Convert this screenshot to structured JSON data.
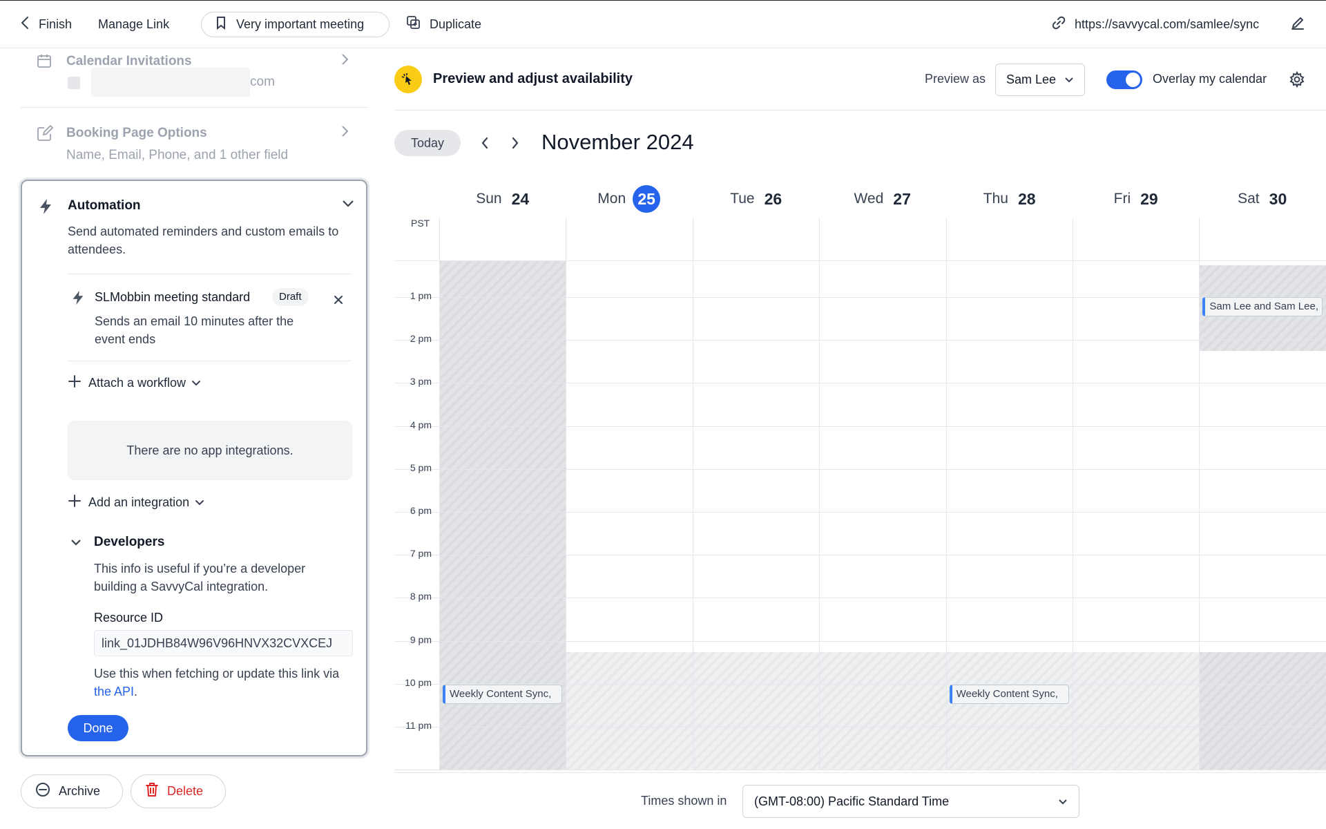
{
  "topbar": {
    "finish_label": "Finish",
    "manage_link_label": "Manage Link",
    "meeting_name": "Very important meeting",
    "duplicate_label": "Duplicate",
    "url": "https://savvycal.com/samlee/sync"
  },
  "left": {
    "calendar_invitations": {
      "title": "Calendar Invitations",
      "email_suffix": "com"
    },
    "booking_page_options": {
      "title": "Booking Page Options",
      "subtitle": "Name, Email, Phone, and 1 other field"
    },
    "automation": {
      "title": "Automation",
      "description": "Send automated reminders and custom emails to attendees.",
      "workflow": {
        "name": "SLMobbin meeting standard",
        "badge": "Draft",
        "description": "Sends an email 10 minutes after the event ends"
      },
      "attach_workflow_label": "Attach a workflow",
      "no_integrations_text": "There are no app integrations.",
      "add_integration_label": "Add an integration",
      "developers": {
        "title": "Developers",
        "description": "This info is useful if you’re a developer building a SavvyCal integration.",
        "resource_id_label": "Resource ID",
        "resource_id_value": "link_01JDHB84W96V96HNVX32CVXCEJ",
        "help_prefix": "Use this when fetching or update this link via ",
        "help_link": "the API",
        "help_suffix": "."
      },
      "done_label": "Done"
    },
    "archive_label": "Archive",
    "delete_label": "Delete"
  },
  "preview": {
    "title": "Preview and adjust availability",
    "preview_as_label": "Preview as",
    "preview_as_value": "Sam Lee",
    "overlay_label": "Overlay my calendar",
    "overlay_enabled": true
  },
  "calendar": {
    "today_label": "Today",
    "month_label": "November 2024",
    "timezone_short": "PST",
    "days": [
      {
        "name": "Sun",
        "num": "24",
        "is_today": false
      },
      {
        "name": "Mon",
        "num": "25",
        "is_today": true
      },
      {
        "name": "Tue",
        "num": "26",
        "is_today": false
      },
      {
        "name": "Wed",
        "num": "27",
        "is_today": false
      },
      {
        "name": "Thu",
        "num": "28",
        "is_today": false
      },
      {
        "name": "Fri",
        "num": "29",
        "is_today": false
      },
      {
        "name": "Sat",
        "num": "30",
        "is_today": false
      }
    ],
    "hours": [
      "1 pm",
      "2 pm",
      "3 pm",
      "4 pm",
      "5 pm",
      "6 pm",
      "7 pm",
      "8 pm",
      "9 pm",
      "10 pm",
      "11 pm"
    ],
    "events": [
      {
        "title": "Sam Lee and Sam Lee,",
        "day": "Sat"
      },
      {
        "title": "Weekly Content Sync,",
        "day": "Sun"
      },
      {
        "title": "Weekly Content Sync,",
        "day": "Thu"
      }
    ],
    "times_shown_in_label": "Times shown in",
    "timezone_value": "(GMT-08:00) Pacific Standard Time"
  },
  "colors": {
    "accent": "#2563eb",
    "danger": "#dc2626",
    "highlight": "#facc15"
  }
}
